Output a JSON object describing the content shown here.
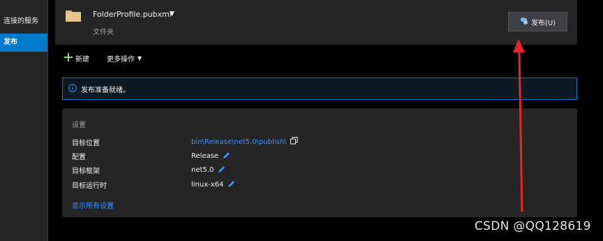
{
  "sidebar": {
    "items": [
      {
        "label": "连接的服务",
        "active": false
      },
      {
        "label": "发布",
        "active": true
      }
    ]
  },
  "header": {
    "profile_name": "FolderProfile.pubxml",
    "profile_type": "文件夹",
    "publish_button": "发布(U)"
  },
  "toolbar": {
    "new_label": "新建",
    "more_label": "更多操作"
  },
  "info": {
    "message": "发布准备就绪。"
  },
  "settings": {
    "title": "设置",
    "rows": [
      {
        "label": "目标位置",
        "value": "bin\\Release\\net5.0\\publish\\"
      },
      {
        "label": "配置",
        "value": "Release"
      },
      {
        "label": "目标框架",
        "value": "net5.0"
      },
      {
        "label": "目标运行时",
        "value": "linux-x64"
      }
    ],
    "show_all": "显示所有设置"
  },
  "watermark": "CSDN @QQ128619",
  "colors": {
    "accent": "#007acc",
    "link": "#3794ff",
    "arrow": "#e8262a"
  }
}
